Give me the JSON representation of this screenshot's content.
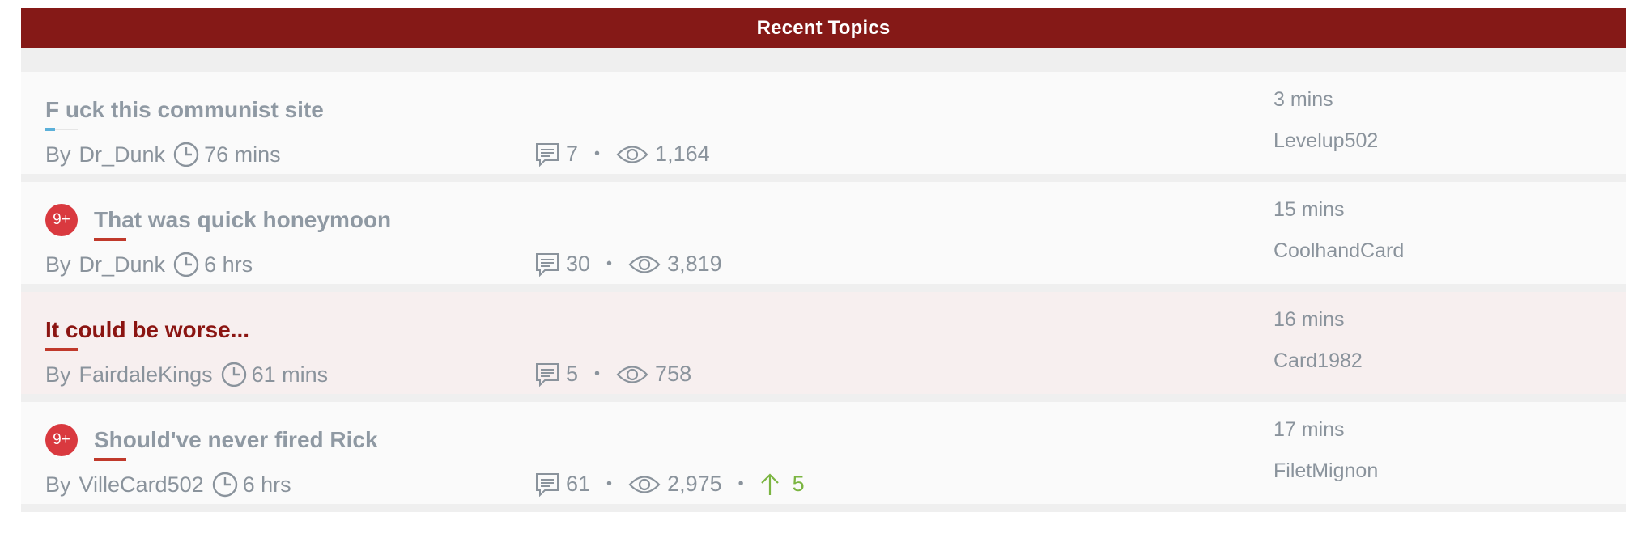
{
  "header": {
    "title": "Recent Topics"
  },
  "topics": [
    {
      "title": "F uck this communist site",
      "badge": "",
      "by_prefix": "By",
      "author": "Dr_Dunk",
      "age": "76 mins",
      "replies": "7",
      "views": "1,164",
      "votes": "",
      "last_time": "3 mins",
      "last_user": "Levelup502"
    },
    {
      "title": "That was quick honeymoon",
      "badge": "9+",
      "by_prefix": "By",
      "author": "Dr_Dunk",
      "age": "6 hrs",
      "replies": "30",
      "views": "3,819",
      "votes": "",
      "last_time": "15 mins",
      "last_user": "CoolhandCard"
    },
    {
      "title": "It could be worse...",
      "badge": "",
      "by_prefix": "By",
      "author": "FairdaleKings",
      "age": "61 mins",
      "replies": "5",
      "views": "758",
      "votes": "",
      "last_time": "16 mins",
      "last_user": "Card1982"
    },
    {
      "title": "Should've never fired Rick",
      "badge": "9+",
      "by_prefix": "By",
      "author": "VilleCard502",
      "age": "6 hrs",
      "replies": "61",
      "views": "2,975",
      "votes": "5",
      "last_time": "17 mins",
      "last_user": "FiletMignon"
    }
  ],
  "separator": "•",
  "colors": {
    "header_bg": "#851917",
    "badge": "#d9393f",
    "hot_title": "#8b1512",
    "vote": "#7bb541"
  }
}
